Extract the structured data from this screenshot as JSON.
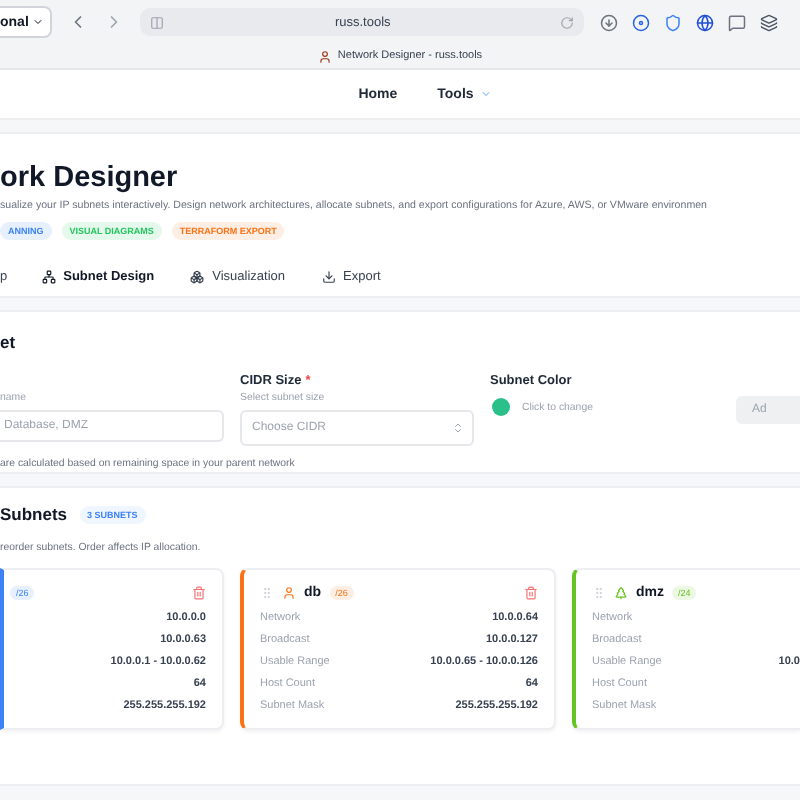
{
  "browser": {
    "profile": "onal",
    "url": "russ.tools",
    "tab_title": "Network Designer - russ.tools"
  },
  "nav": {
    "items": [
      {
        "label": "Home",
        "kind": "link"
      },
      {
        "label": "Tools",
        "kind": "menu"
      }
    ]
  },
  "header": {
    "title": "ork Designer",
    "description": "sualize your IP subnets interactively. Design network architectures, allocate subnets, and export configurations for Azure, AWS, or VMware environmen",
    "badges": [
      {
        "label": "ANNING",
        "color": "#3b82f6"
      },
      {
        "label": "VISUAL DIAGRAMS",
        "color": "#22c55e"
      },
      {
        "label": "TERRAFORM EXPORT",
        "color": "#f97316"
      }
    ],
    "tabs": [
      {
        "label": "p",
        "selected": false
      },
      {
        "label": "Subnet Design",
        "selected": true
      },
      {
        "label": "Visualization",
        "selected": false
      },
      {
        "label": "Export",
        "selected": false
      }
    ]
  },
  "form": {
    "title": "et",
    "name_label": "name",
    "name_placeholder": "Database, DMZ",
    "cidr_label": "CIDR Size",
    "required_mark": "*",
    "cidr_hint": "Select subnet size",
    "cidr_placeholder": "Choose CIDR",
    "color_label": "Subnet Color",
    "color": "#2bbf8a",
    "color_hint": "Click to change",
    "add_button": "Ad",
    "add_disabled": true,
    "note": "are calculated based on remaining space in your parent network"
  },
  "subnets": {
    "title": "Subnets",
    "count": "3 SUBNETS",
    "hint": "reorder subnets. Order affects IP allocation.",
    "items": [
      {
        "cidr": "/26",
        "color": "#3b82f6",
        "rows": [
          {
            "value": "10.0.0.0"
          },
          {
            "value": "10.0.0.63"
          },
          {
            "value": "10.0.0.1 - 10.0.0.62"
          },
          {
            "value": "64"
          },
          {
            "value": "255.255.255.192"
          }
        ]
      },
      {
        "name": "db",
        "cidr": "/26",
        "color": "#f97316",
        "rows": [
          {
            "label": "Network",
            "value": "10.0.0.64"
          },
          {
            "label": "Broadcast",
            "value": "10.0.0.127"
          },
          {
            "label": "Usable Range",
            "value": "10.0.0.65 - 10.0.0.126"
          },
          {
            "label": "Host Count",
            "value": "64"
          },
          {
            "label": "Subnet Mask",
            "value": "255.255.255.192"
          }
        ]
      },
      {
        "name": "dmz",
        "cidr": "/24",
        "color": "#65c421",
        "rows": [
          {
            "label": "Network"
          },
          {
            "label": "Broadcast"
          },
          {
            "label": "Usable Range",
            "value": "10.0"
          },
          {
            "label": "Host Count"
          },
          {
            "label": "Subnet Mask"
          }
        ]
      }
    ]
  }
}
